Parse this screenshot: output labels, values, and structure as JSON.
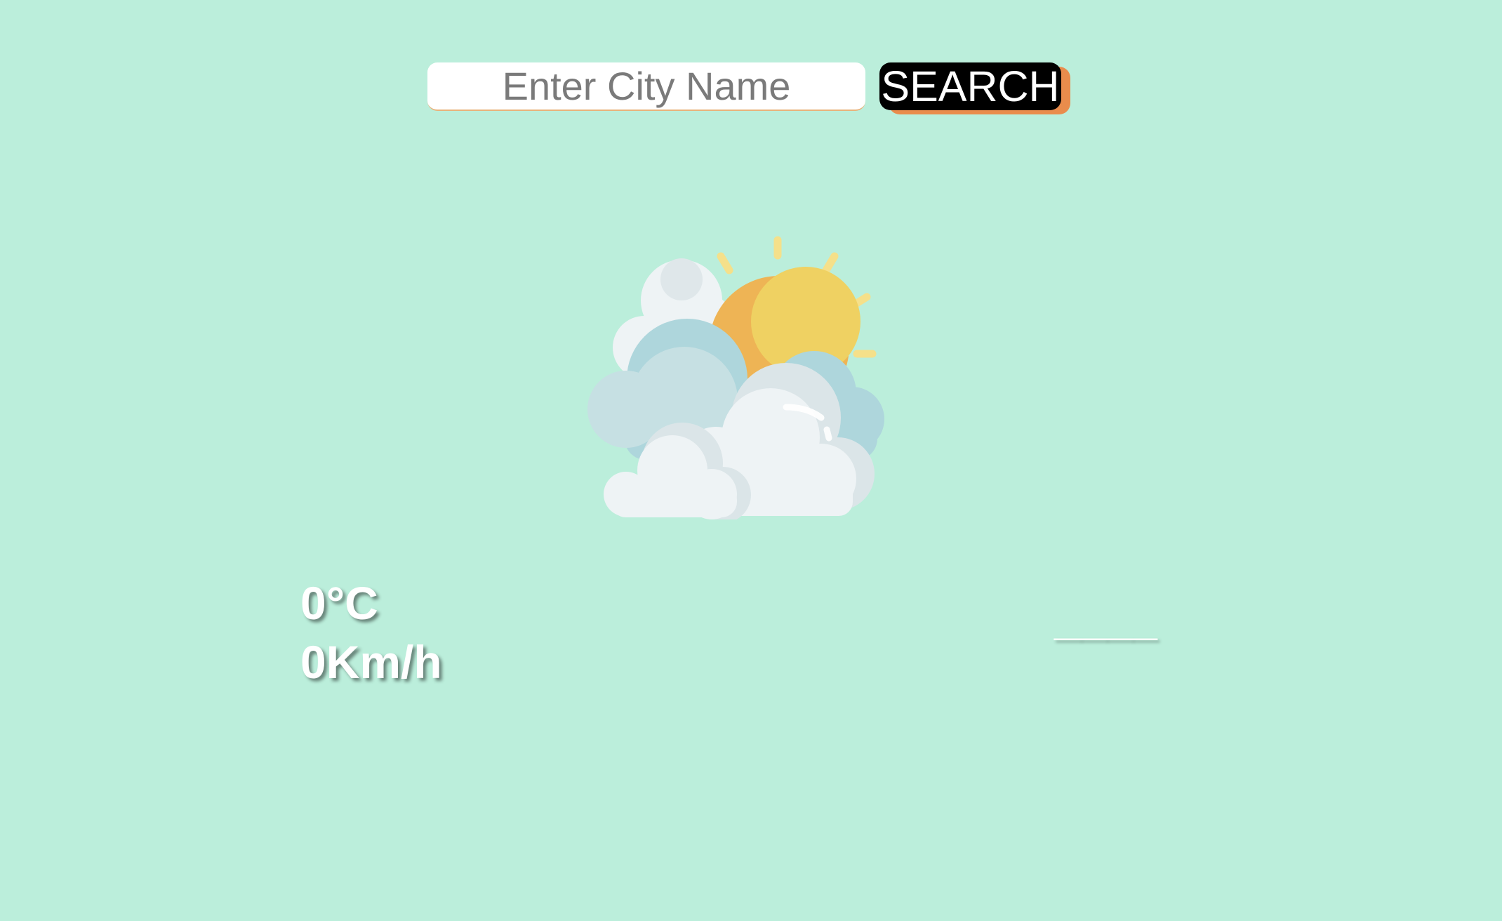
{
  "search": {
    "placeholder": "Enter City Name",
    "value": "",
    "button_label": "SEARCH"
  },
  "weather": {
    "icon": "partly-cloudy-icon",
    "temperature": "0°C",
    "wind_speed": "0Km/h",
    "city": "____"
  },
  "colors": {
    "background": "#bbeedb",
    "button": "#000000",
    "button_shadow": "#e98c4c",
    "text": "#ffffff"
  }
}
